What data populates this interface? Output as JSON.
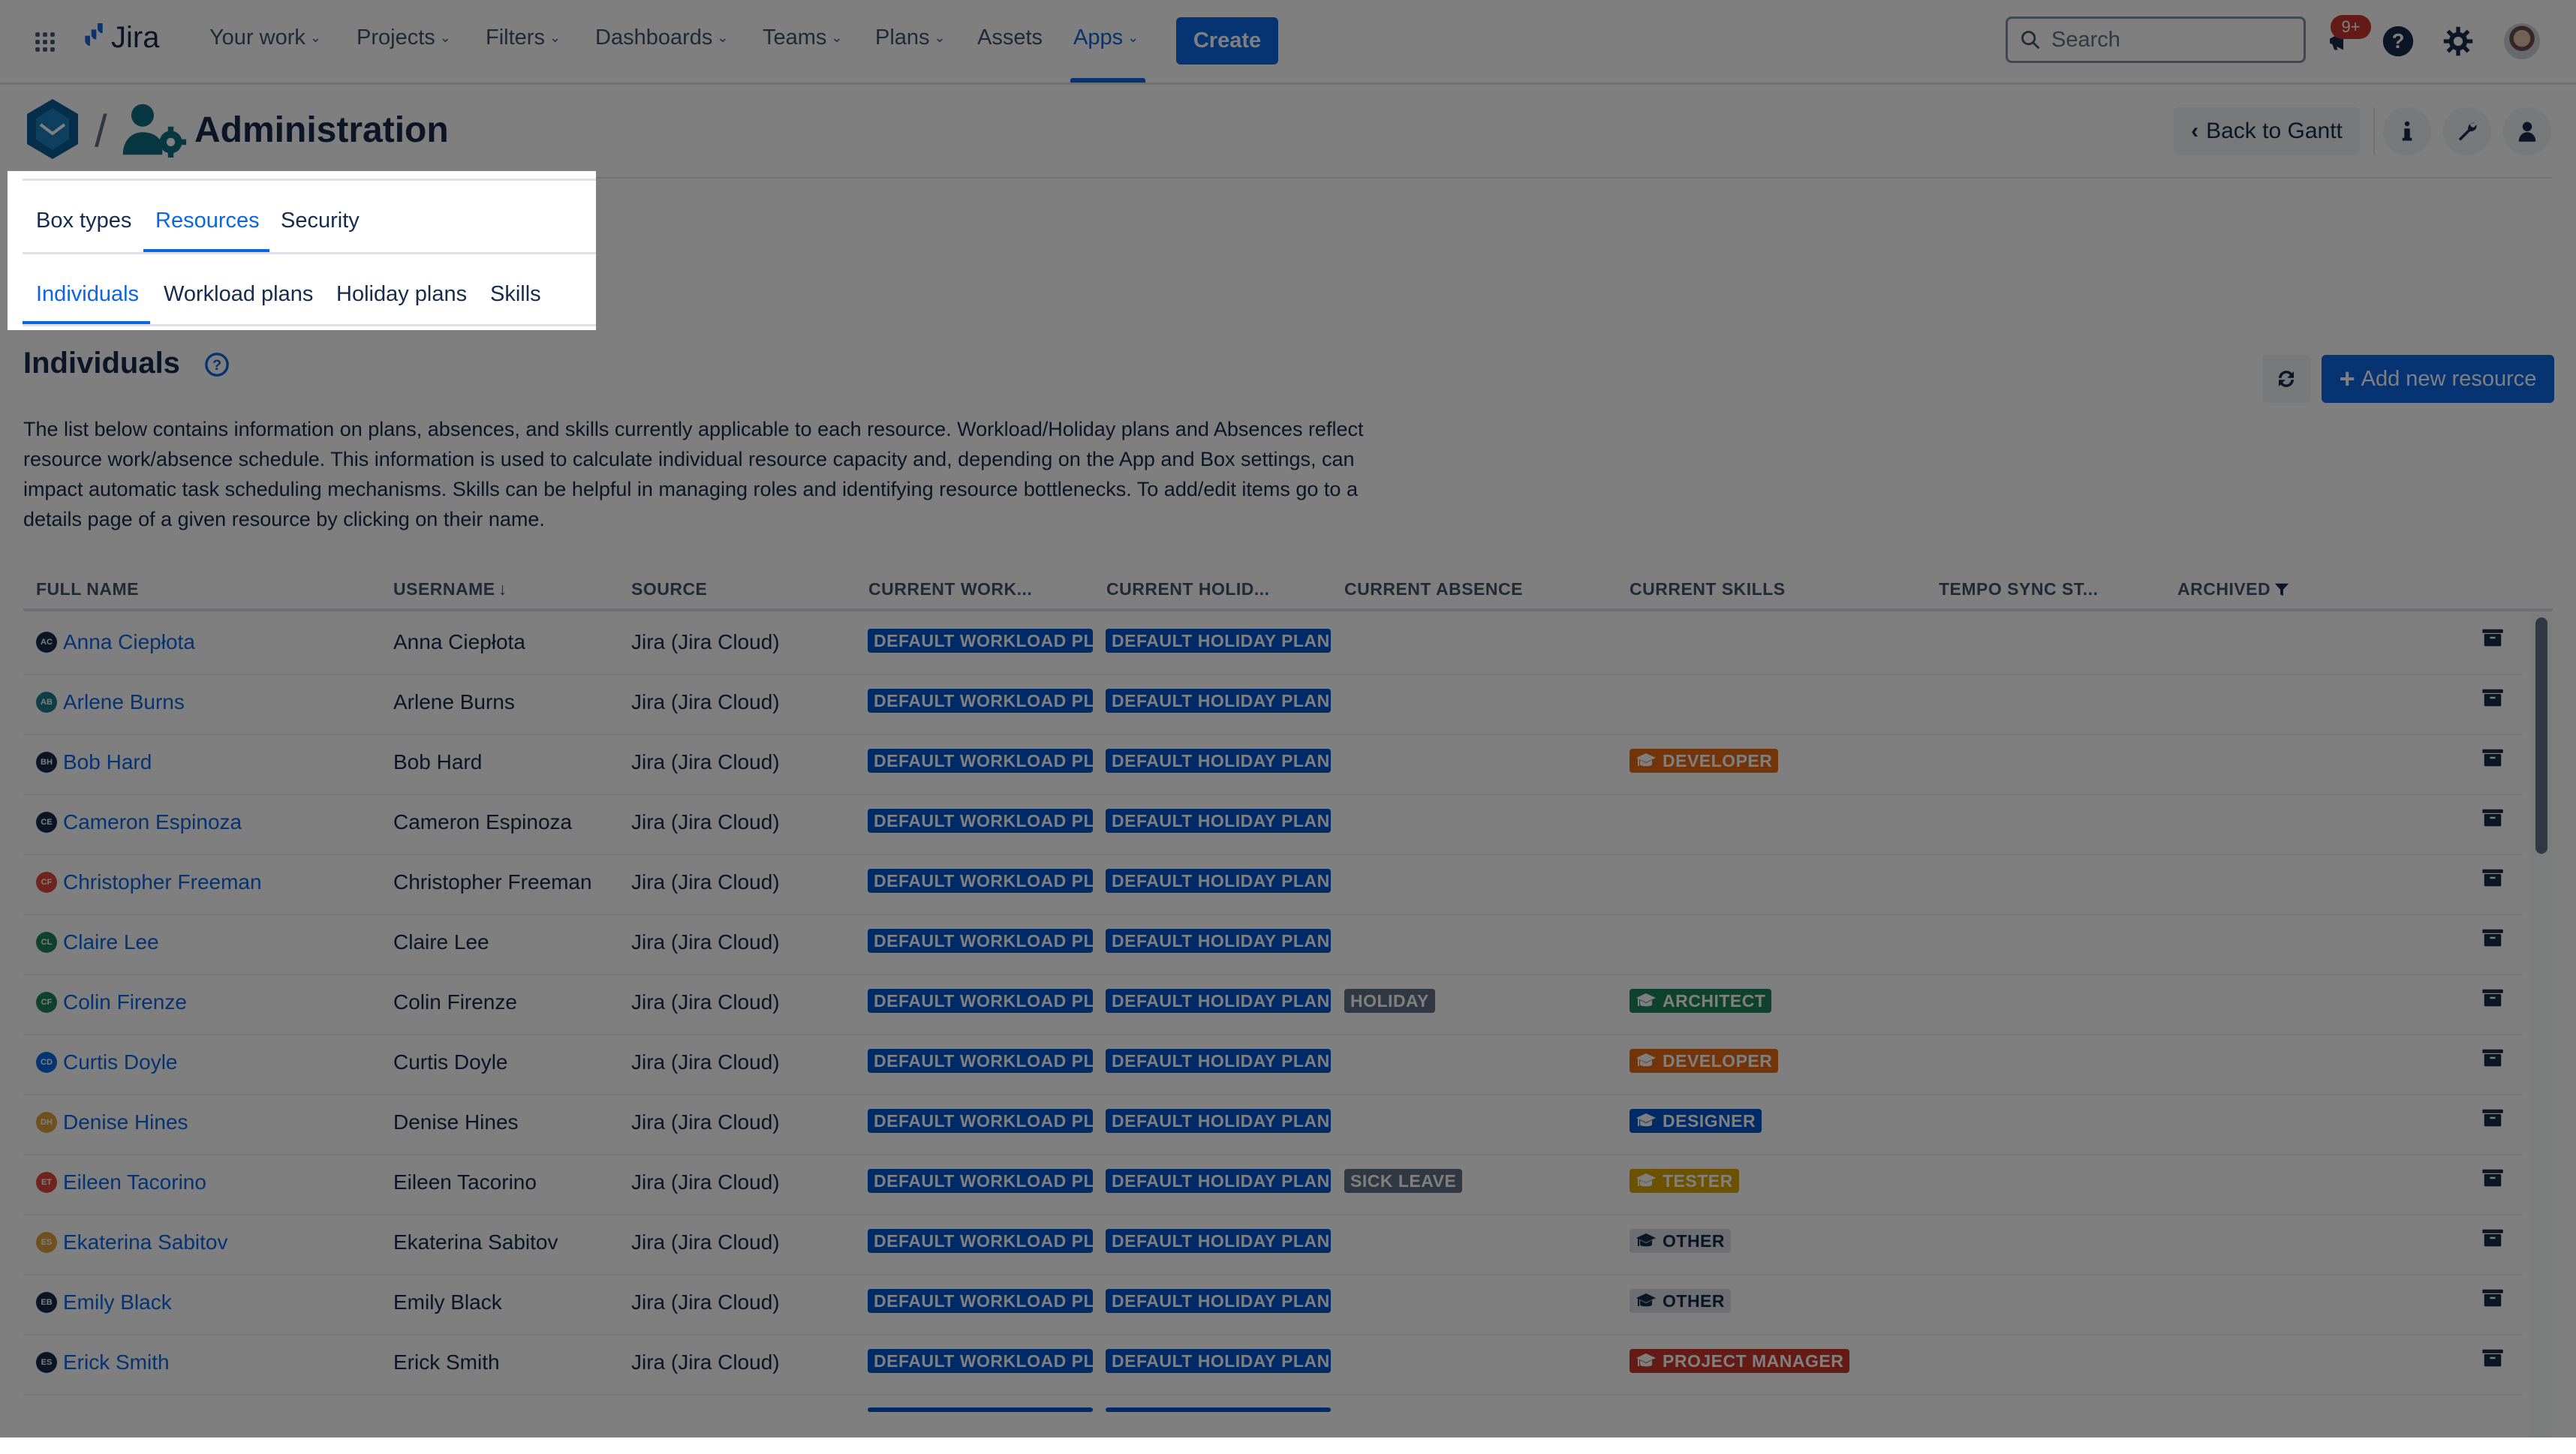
{
  "topnav": {
    "product": "Jira",
    "items": [
      {
        "label": "Your work",
        "dropdown": true
      },
      {
        "label": "Projects",
        "dropdown": true
      },
      {
        "label": "Filters",
        "dropdown": true
      },
      {
        "label": "Dashboards",
        "dropdown": true
      },
      {
        "label": "Teams",
        "dropdown": true
      },
      {
        "label": "Plans",
        "dropdown": true
      },
      {
        "label": "Assets",
        "dropdown": false
      },
      {
        "label": "Apps",
        "dropdown": true,
        "active": true
      }
    ],
    "create_label": "Create",
    "search_placeholder": "Search",
    "notifications_badge": "9+",
    "icons": [
      "app-switcher-icon",
      "jira-logo-icon",
      "notifications-icon",
      "help-icon",
      "settings-icon",
      "avatar"
    ]
  },
  "header": {
    "title": "Administration",
    "back_label": "Back to Gantt",
    "icons": [
      "app-logo-icon",
      "admin-user-gear-icon",
      "info-icon",
      "wrench-icon",
      "user-icon"
    ]
  },
  "tabs": {
    "primary": [
      {
        "label": "Box types"
      },
      {
        "label": "Resources",
        "active": true
      },
      {
        "label": "Security"
      }
    ],
    "secondary": [
      {
        "label": "Individuals",
        "active": true
      },
      {
        "label": "Workload plans"
      },
      {
        "label": "Holiday plans"
      },
      {
        "label": "Skills"
      }
    ]
  },
  "page": {
    "heading": "Individuals",
    "add_label": "Add new resource",
    "description": "The list below contains information on plans, absences, and skills currently applicable to each resource. Workload/Holiday plans and Absences reflect resource work/absence schedule. This information is used to calculate individual resource capacity and, depending on the App and Box settings, can impact automatic task scheduling mechanisms. Skills can be helpful in managing roles and identifying resource bottlenecks. To add/edit items go to a details page of a given resource by clicking on their name."
  },
  "colors": {
    "accent": "#0c66e4",
    "workload_plan": "#0055cc",
    "absence": "#626f86",
    "skill_developer": "#e56910",
    "skill_architect": "#1f845a",
    "skill_designer": "#0055cc",
    "skill_tester": "#d9a300",
    "skill_other": "#dcdfe4",
    "skill_project_manager": "#c9372c"
  },
  "table": {
    "columns": [
      {
        "label": "FULL NAME"
      },
      {
        "label": "USERNAME",
        "sort": "desc"
      },
      {
        "label": "SOURCE"
      },
      {
        "label": "CURRENT WORK..."
      },
      {
        "label": "CURRENT HOLID..."
      },
      {
        "label": "CURRENT ABSENCE"
      },
      {
        "label": "CURRENT SKILLS"
      },
      {
        "label": "TEMPO SYNC ST..."
      },
      {
        "label": "ARCHIVED",
        "filter": true
      }
    ],
    "rows": [
      {
        "initials": "AC",
        "avatar_color": "#172b4d",
        "full_name": "Anna Ciepłota",
        "username": "Anna Ciepłota",
        "source": "Jira (Jira Cloud)",
        "workload": "DEFAULT WORKLOAD PLAN",
        "holiday": "DEFAULT HOLIDAY PLAN",
        "absence": "",
        "skill": ""
      },
      {
        "initials": "AB",
        "avatar_color": "#1d7f8c",
        "full_name": "Arlene Burns",
        "username": "Arlene Burns",
        "source": "Jira (Jira Cloud)",
        "workload": "DEFAULT WORKLOAD PLAN",
        "holiday": "DEFAULT HOLIDAY PLAN",
        "absence": "",
        "skill": ""
      },
      {
        "initials": "BH",
        "avatar_color": "#172b4d",
        "full_name": "Bob Hard",
        "username": "Bob Hard",
        "source": "Jira (Jira Cloud)",
        "workload": "DEFAULT WORKLOAD PLAN",
        "holiday": "DEFAULT HOLIDAY PLAN",
        "absence": "",
        "skill": "DEVELOPER",
        "skill_color": "#e56910",
        "skill_text": "#ffffff"
      },
      {
        "initials": "CE",
        "avatar_color": "#172b4d",
        "full_name": "Cameron Espinoza",
        "username": "Cameron Espinoza",
        "source": "Jira (Jira Cloud)",
        "workload": "DEFAULT WORKLOAD PLAN",
        "holiday": "DEFAULT HOLIDAY PLAN",
        "absence": "",
        "skill": ""
      },
      {
        "initials": "CF",
        "avatar_color": "#e2483d",
        "full_name": "Christopher Freeman",
        "username": "Christopher Freeman",
        "source": "Jira (Jira Cloud)",
        "workload": "DEFAULT WORKLOAD PLAN",
        "holiday": "DEFAULT HOLIDAY PLAN",
        "absence": "",
        "skill": ""
      },
      {
        "initials": "CL",
        "avatar_color": "#1f845a",
        "full_name": "Claire Lee",
        "username": "Claire Lee",
        "source": "Jira (Jira Cloud)",
        "workload": "DEFAULT WORKLOAD PLAN",
        "holiday": "DEFAULT HOLIDAY PLAN",
        "absence": "",
        "skill": ""
      },
      {
        "initials": "CF",
        "avatar_color": "#1f845a",
        "full_name": "Colin Firenze",
        "username": "Colin Firenze",
        "source": "Jira (Jira Cloud)",
        "workload": "DEFAULT WORKLOAD PLAN",
        "holiday": "DEFAULT HOLIDAY PLAN",
        "absence": "HOLIDAY",
        "skill": "ARCHITECT",
        "skill_color": "#1f845a",
        "skill_text": "#ffffff"
      },
      {
        "initials": "CD",
        "avatar_color": "#0c66e4",
        "full_name": "Curtis Doyle",
        "username": "Curtis Doyle",
        "source": "Jira (Jira Cloud)",
        "workload": "DEFAULT WORKLOAD PLAN",
        "holiday": "DEFAULT HOLIDAY PLAN",
        "absence": "",
        "skill": "DEVELOPER",
        "skill_color": "#e56910",
        "skill_text": "#ffffff"
      },
      {
        "initials": "DH",
        "avatar_color": "#e2a03f",
        "full_name": "Denise Hines",
        "username": "Denise Hines",
        "source": "Jira (Jira Cloud)",
        "workload": "DEFAULT WORKLOAD PLAN",
        "holiday": "DEFAULT HOLIDAY PLAN",
        "absence": "",
        "skill": "DESIGNER",
        "skill_color": "#0055cc",
        "skill_text": "#ffffff"
      },
      {
        "initials": "ET",
        "avatar_color": "#e2483d",
        "full_name": "Eileen Tacorino",
        "username": "Eileen Tacorino",
        "source": "Jira (Jira Cloud)",
        "workload": "DEFAULT WORKLOAD PLAN",
        "holiday": "DEFAULT HOLIDAY PLAN",
        "absence": "SICK LEAVE",
        "skill": "TESTER",
        "skill_color": "#d9a300",
        "skill_text": "#ffffff"
      },
      {
        "initials": "ES",
        "avatar_color": "#e2a03f",
        "full_name": "Ekaterina Sabitov",
        "username": "Ekaterina Sabitov",
        "source": "Jira (Jira Cloud)",
        "workload": "DEFAULT WORKLOAD PLAN",
        "holiday": "DEFAULT HOLIDAY PLAN",
        "absence": "",
        "skill": "OTHER",
        "skill_color": "#dcdfe4",
        "skill_text": "#172b4d"
      },
      {
        "initials": "EB",
        "avatar_color": "#172b4d",
        "full_name": "Emily Black",
        "username": "Emily Black",
        "source": "Jira (Jira Cloud)",
        "workload": "DEFAULT WORKLOAD PLAN",
        "holiday": "DEFAULT HOLIDAY PLAN",
        "absence": "",
        "skill": "OTHER",
        "skill_color": "#dcdfe4",
        "skill_text": "#172b4d"
      },
      {
        "initials": "ES",
        "avatar_color": "#172b4d",
        "full_name": "Erick Smith",
        "username": "Erick Smith",
        "source": "Jira (Jira Cloud)",
        "workload": "DEFAULT WORKLOAD PLAN",
        "holiday": "DEFAULT HOLIDAY PLAN",
        "absence": "",
        "skill": "PROJECT MANAGER",
        "skill_color": "#c9372c",
        "skill_text": "#ffffff"
      }
    ]
  }
}
